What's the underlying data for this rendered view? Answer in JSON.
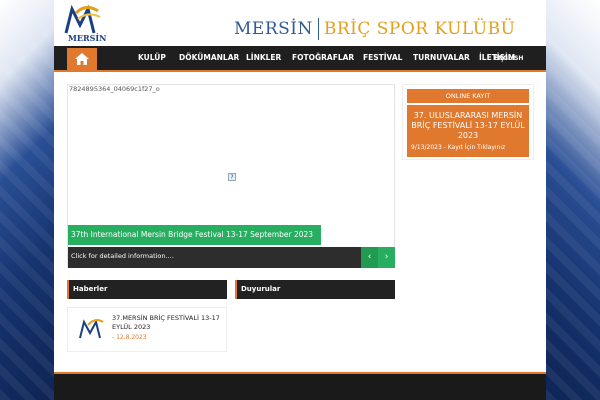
{
  "header": {
    "logo_text": "MERSİN",
    "title_left": "MERSİN",
    "title_right": "BRİÇ SPOR KULÜBÜ"
  },
  "nav": {
    "home_icon": "home-icon",
    "items": [
      "KULÜP",
      "DÖKÜMANLAR",
      "LİNKLER",
      "FOTOĞRAFLAR",
      "FESTİVAL",
      "TURNUVALAR",
      "İLETİŞİM"
    ],
    "language": "ENGLISH"
  },
  "slider": {
    "image_alt": "7824895364_04069c1f27_o",
    "caption": "37th International Mersin Bridge Festival 13-17 September 2023",
    "info": "Click for detailed information....",
    "prev_icon": "chevron-left-icon",
    "next_icon": "chevron-right-icon",
    "broken_image_glyph": "?"
  },
  "panels": {
    "news_title": "Haberler",
    "announcements_title": "Duyurular"
  },
  "news": [
    {
      "title": "37.MERSİN BRİÇ FESTİVALİ 13-17 EYLÜL 2023",
      "date": "- 12.8.2023"
    }
  ],
  "registration": {
    "header": "ONLINE KAYIT",
    "title": "37. ULUSLARARASI MERSİN BRİÇ FESTİVALİ 13-17 EYLÜL 2023",
    "note": "9/13/2023 - Kayıt İçin Tıklayınız"
  },
  "colors": {
    "accent": "#e0782e",
    "green": "#27ae60",
    "nav_bg": "#1f1f1f",
    "brand_blue": "#2f5a93",
    "brand_gold": "#e3a01b"
  }
}
